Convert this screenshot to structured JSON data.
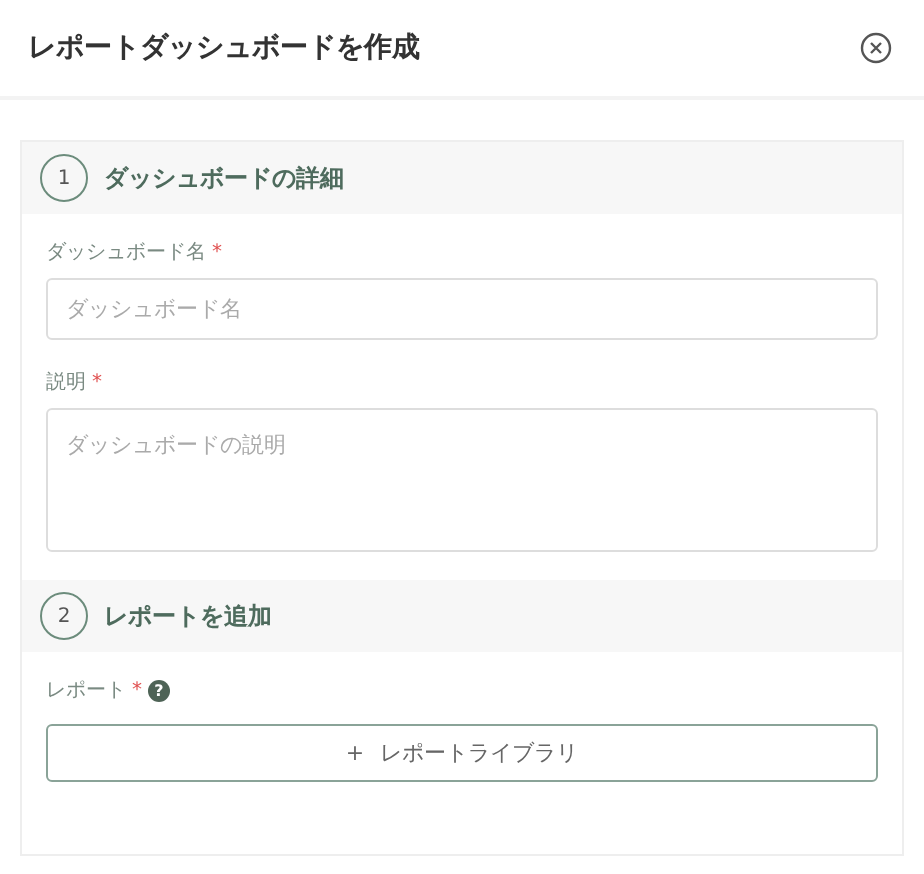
{
  "dialog": {
    "title": "レポートダッシュボードを作成"
  },
  "sections": [
    {
      "number": "1",
      "title": "ダッシュボードの詳細",
      "fields": [
        {
          "kind": "input",
          "label": "ダッシュボード名",
          "required_mark": "*",
          "placeholder": "ダッシュボード名"
        },
        {
          "kind": "textarea",
          "label": "説明",
          "required_mark": "*",
          "placeholder": "ダッシュボードの説明"
        }
      ]
    },
    {
      "number": "2",
      "title": "レポートを追加",
      "fields": [
        {
          "kind": "button",
          "label": "レポート",
          "required_mark": "*",
          "help": "?",
          "button_icon": "+",
          "button_label": "レポートライブラリ"
        }
      ]
    }
  ]
}
